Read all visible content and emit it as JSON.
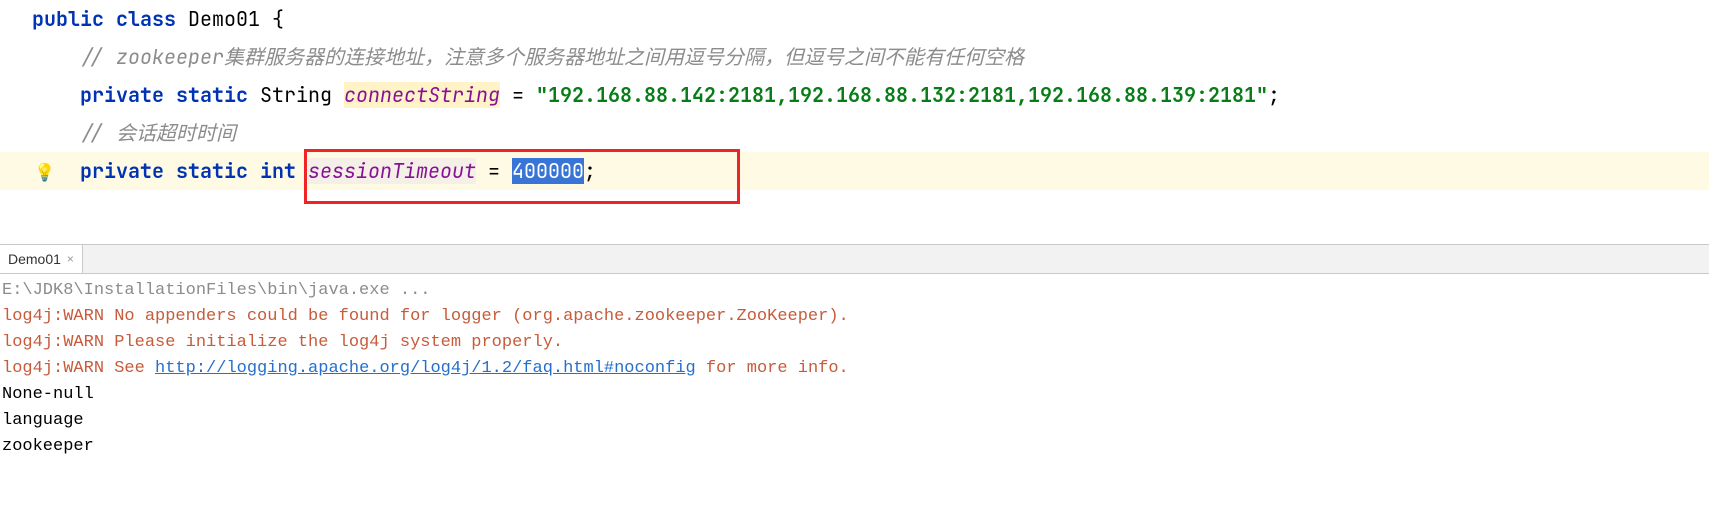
{
  "code": {
    "line1": {
      "kw1": "public",
      "kw2": "class",
      "cls": "Demo01",
      "brace": "{"
    },
    "line2": {
      "cmt": "// zookeeper集群服务器的连接地址，注意多个服务器地址之间用逗号分隔，但逗号之间不能有任何空格"
    },
    "line3": {
      "kw1": "private",
      "kw2": "static",
      "typ": "String",
      "fld": "connectString",
      "eq": "=",
      "str": "\"192.168.88.142:2181,192.168.88.132:2181,192.168.88.139:2181\"",
      "sc": ";"
    },
    "line4": {
      "cmt": "// 会话超时时间"
    },
    "line5": {
      "kw1": "private",
      "kw2": "static",
      "typ": "int",
      "fld": "sessionTimeout",
      "eq": "=",
      "val": "400000",
      "sc": ";"
    }
  },
  "tab": {
    "label": "Demo01",
    "close": "×"
  },
  "console": {
    "l1": "E:\\JDK8\\InstallationFiles\\bin\\java.exe ...",
    "l2a": "log4j:WARN No appenders could be found for logger (org.apache.zookeeper.ZooKeeper).",
    "l3a": "log4j:WARN Please initialize the log4j system properly.",
    "l4a": "log4j:WARN See ",
    "l4b": "http://logging.apache.org/log4j/1.2/faq.html#noconfig",
    "l4c": " for more info.",
    "l5": "None-null",
    "l6": "language",
    "l7": "zookeeper"
  }
}
